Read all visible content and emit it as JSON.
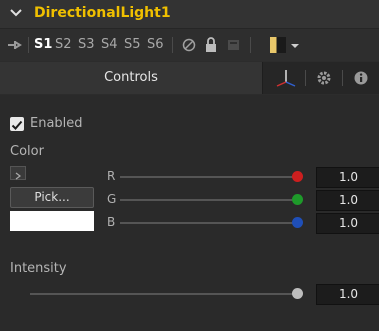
{
  "header": {
    "title": "DirectionalLight1"
  },
  "toolbar": {
    "slots": [
      "S1",
      "S2",
      "S3",
      "S4",
      "S5",
      "S6"
    ],
    "active_slot": "S1"
  },
  "tabs": {
    "controls_label": "Controls"
  },
  "controls": {
    "enabled_label": "Enabled",
    "enabled_checked": true,
    "color_label": "Color",
    "pick_label": "Pick...",
    "channels": [
      {
        "label": "R",
        "value": "1.0",
        "knob_color": "#cc1f1f"
      },
      {
        "label": "G",
        "value": "1.0",
        "knob_color": "#1e9a2a"
      },
      {
        "label": "B",
        "value": "1.0",
        "knob_color": "#1f4fb8"
      }
    ],
    "intensity_label": "Intensity",
    "intensity_value": "1.0"
  },
  "colors": {
    "title": "#f0c000",
    "color_swatch": "#ffffff"
  }
}
